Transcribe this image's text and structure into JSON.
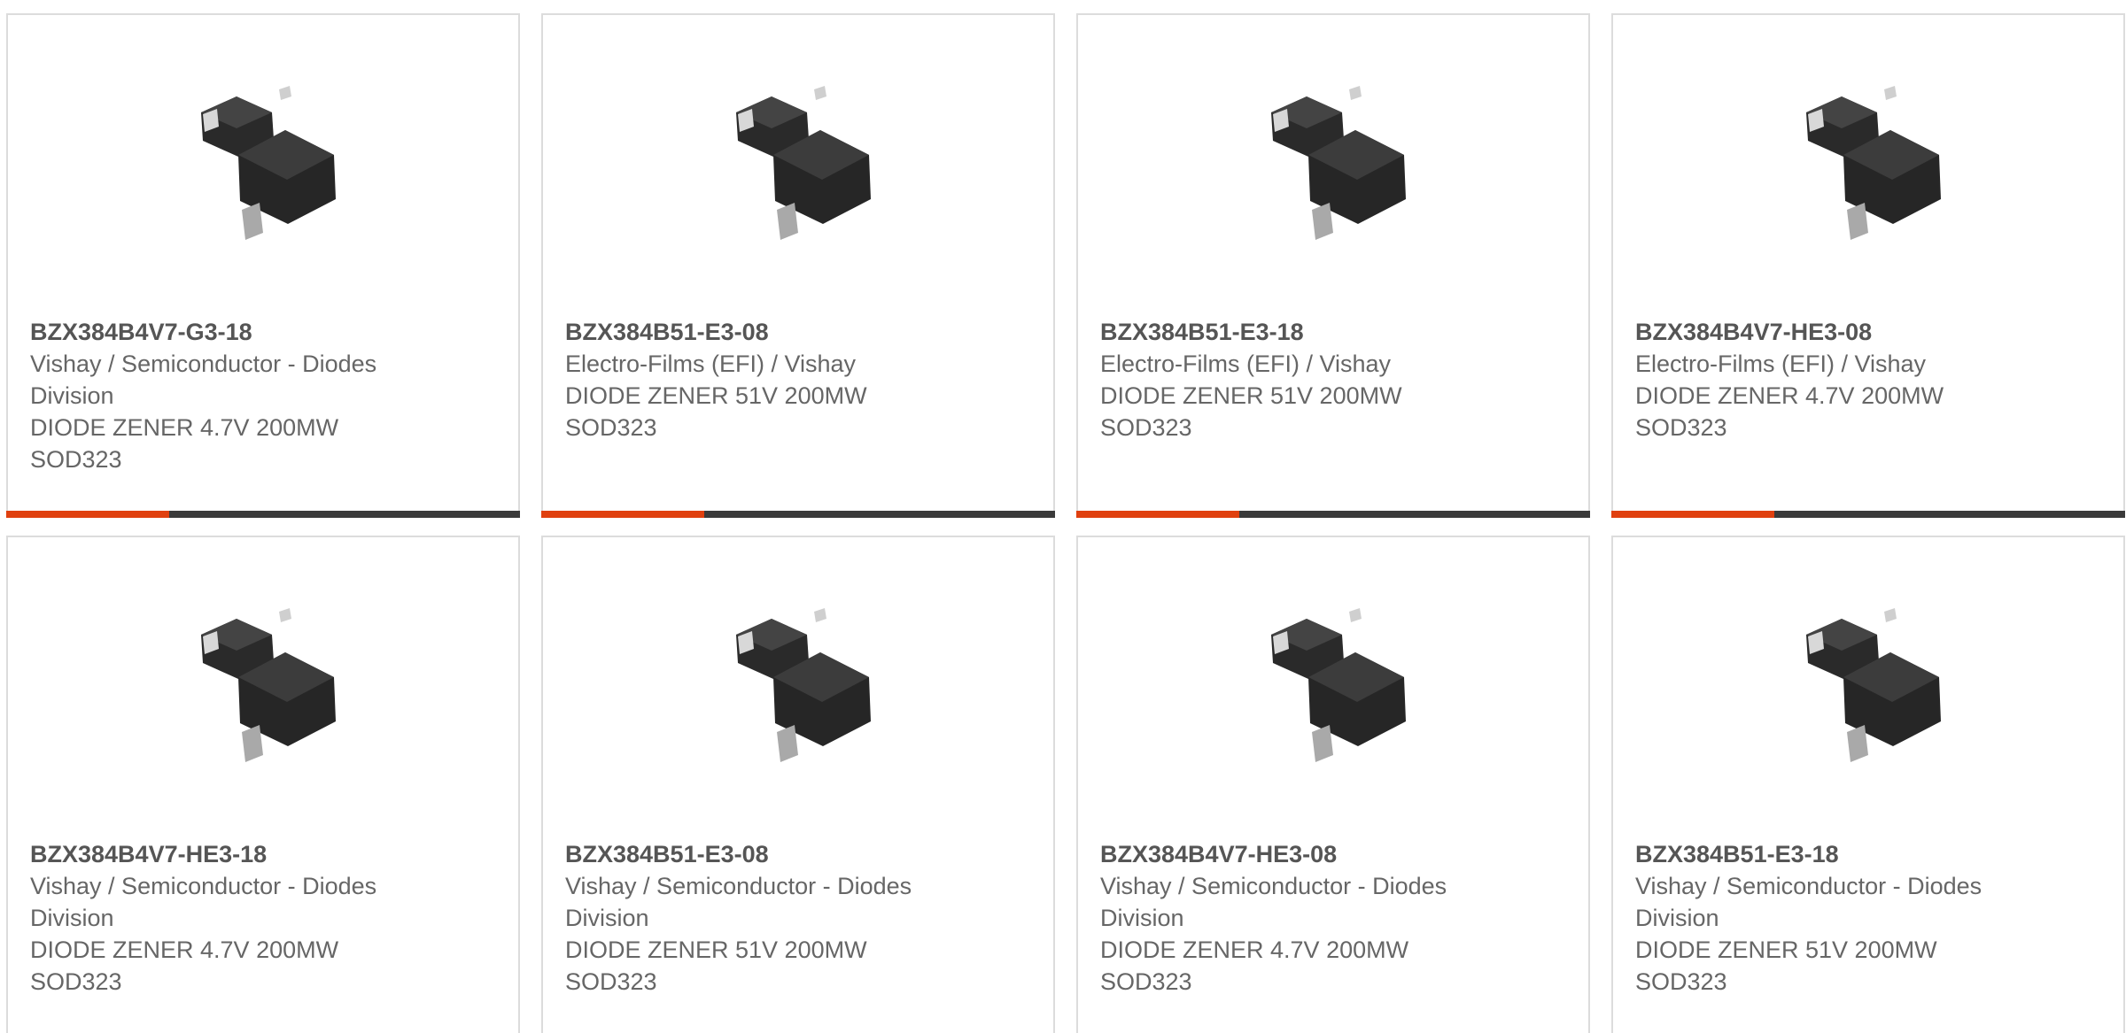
{
  "products": [
    {
      "part_number": "BZX384B4V7-G3-18",
      "manufacturer": "Vishay / Semiconductor - Diodes Division",
      "description": "DIODE ZENER 4.7V 200MW",
      "package": "SOD323"
    },
    {
      "part_number": "BZX384B51-E3-08",
      "manufacturer": "Electro-Films (EFI) / Vishay",
      "description": "DIODE ZENER 51V 200MW",
      "package": "SOD323"
    },
    {
      "part_number": "BZX384B51-E3-18",
      "manufacturer": "Electro-Films (EFI) / Vishay",
      "description": "DIODE ZENER 51V 200MW",
      "package": "SOD323"
    },
    {
      "part_number": "BZX384B4V7-HE3-08",
      "manufacturer": "Electro-Films (EFI) / Vishay",
      "description": "DIODE ZENER 4.7V 200MW",
      "package": "SOD323"
    },
    {
      "part_number": "BZX384B4V7-HE3-18",
      "manufacturer": "Vishay / Semiconductor - Diodes Division",
      "description": "DIODE ZENER 4.7V 200MW",
      "package": "SOD323"
    },
    {
      "part_number": "BZX384B51-E3-08",
      "manufacturer": "Vishay / Semiconductor - Diodes Division",
      "description": "DIODE ZENER 51V 200MW",
      "package": "SOD323"
    },
    {
      "part_number": "BZX384B4V7-HE3-08",
      "manufacturer": "Vishay / Semiconductor - Diodes Division",
      "description": "DIODE ZENER 4.7V 200MW",
      "package": "SOD323"
    },
    {
      "part_number": "BZX384B51-E3-18",
      "manufacturer": "Vishay / Semiconductor - Diodes Division",
      "description": "DIODE ZENER 51V 200MW",
      "package": "SOD323"
    }
  ],
  "theme": {
    "accent": "#e0400f",
    "bar": "#3a3a3a",
    "border": "#dcdcdc",
    "text": "#666666"
  },
  "icons": {
    "product_image": "sod323-diode-package-image"
  }
}
